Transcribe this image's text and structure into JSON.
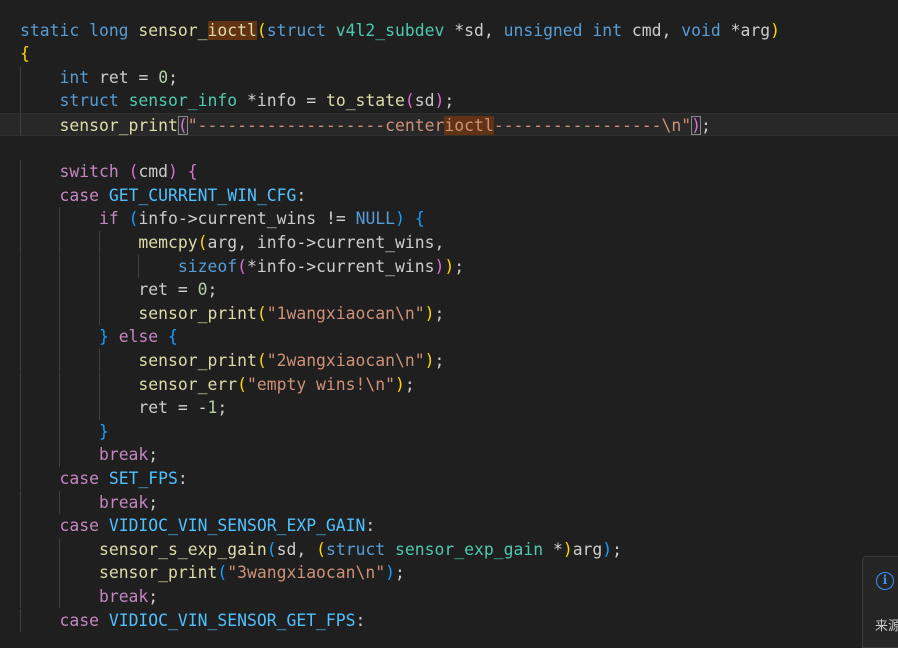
{
  "editor": {
    "language": "c",
    "current_line": 4,
    "highlight_word": "ioctl",
    "lines": [
      [
        [
          "static ",
          "kw"
        ],
        [
          "long ",
          "kw"
        ],
        [
          "sensor_",
          "fn"
        ],
        [
          "ioctl",
          "fn hl"
        ],
        [
          "(",
          "b1"
        ],
        [
          "struct ",
          "kw"
        ],
        [
          "v4l2_subdev ",
          "type"
        ],
        [
          "*",
          "op"
        ],
        [
          "sd",
          ""
        ],
        [
          ", ",
          ""
        ],
        [
          "unsigned ",
          "kw"
        ],
        [
          "int ",
          "kw"
        ],
        [
          "cmd",
          ""
        ],
        [
          ", ",
          ""
        ],
        [
          "void ",
          "kw"
        ],
        [
          "*",
          "op"
        ],
        [
          "arg",
          ""
        ],
        [
          ")",
          "b1"
        ]
      ],
      [
        [
          "{",
          "b1"
        ]
      ],
      [
        [
          "    ",
          ""
        ],
        [
          "int ",
          "kw"
        ],
        [
          "ret",
          ""
        ],
        [
          " = ",
          "op"
        ],
        [
          "0",
          "num"
        ],
        [
          ";",
          ""
        ]
      ],
      [
        [
          "    ",
          ""
        ],
        [
          "struct ",
          "kw"
        ],
        [
          "sensor_info ",
          "type"
        ],
        [
          "*",
          "op"
        ],
        [
          "info",
          ""
        ],
        [
          " = ",
          "op"
        ],
        [
          "to_state",
          "fn"
        ],
        [
          "(",
          "b2"
        ],
        [
          "sd",
          ""
        ],
        [
          ")",
          "b2"
        ],
        [
          ";",
          ""
        ]
      ],
      [
        [
          "    ",
          ""
        ],
        [
          "sensor_print",
          "fn"
        ],
        [
          "(",
          "b2 bm"
        ],
        [
          "\"-------------------center",
          "str"
        ],
        [
          "ioctl",
          "str hl"
        ],
        [
          "-----------------\\n\"",
          "str"
        ],
        [
          ")",
          "b2 bm"
        ],
        [
          ";",
          ""
        ]
      ],
      [],
      [
        [
          "    ",
          ""
        ],
        [
          "switch ",
          "ctrl"
        ],
        [
          "(",
          "b2"
        ],
        [
          "cmd",
          ""
        ],
        [
          ") ",
          "b2"
        ],
        [
          "{",
          "b2"
        ]
      ],
      [
        [
          "    ",
          ""
        ],
        [
          "case ",
          "ctrl"
        ],
        [
          "GET_CURRENT_WIN_CFG",
          "mac"
        ],
        [
          ":",
          ""
        ]
      ],
      [
        [
          "        ",
          ""
        ],
        [
          "if ",
          "ctrl"
        ],
        [
          "(",
          "b3"
        ],
        [
          "info",
          ""
        ],
        [
          "->",
          "op"
        ],
        [
          "current_wins",
          ""
        ],
        [
          " != ",
          "op"
        ],
        [
          "NULL",
          "const"
        ],
        [
          ") ",
          "b3"
        ],
        [
          "{",
          "b3"
        ]
      ],
      [
        [
          "            ",
          ""
        ],
        [
          "memcpy",
          "fn"
        ],
        [
          "(",
          "b1"
        ],
        [
          "arg",
          ""
        ],
        [
          ", ",
          ""
        ],
        [
          "info",
          ""
        ],
        [
          "->",
          "op"
        ],
        [
          "current_wins",
          ""
        ],
        [
          ",",
          ""
        ]
      ],
      [
        [
          "                ",
          ""
        ],
        [
          "sizeof",
          "kw"
        ],
        [
          "(",
          "b2"
        ],
        [
          "*",
          "op"
        ],
        [
          "info",
          ""
        ],
        [
          "->",
          "op"
        ],
        [
          "current_wins",
          ""
        ],
        [
          ")",
          "b2"
        ],
        [
          ")",
          "b1"
        ],
        [
          ";",
          ""
        ]
      ],
      [
        [
          "            ",
          ""
        ],
        [
          "ret",
          ""
        ],
        [
          " = ",
          "op"
        ],
        [
          "0",
          "num"
        ],
        [
          ";",
          ""
        ]
      ],
      [
        [
          "            ",
          ""
        ],
        [
          "sensor_print",
          "fn"
        ],
        [
          "(",
          "b1"
        ],
        [
          "\"1wangxiaocan\\n\"",
          "str"
        ],
        [
          ")",
          "b1"
        ],
        [
          ";",
          ""
        ]
      ],
      [
        [
          "        ",
          ""
        ],
        [
          "} ",
          "b3"
        ],
        [
          "else ",
          "ctrl"
        ],
        [
          "{",
          "b3"
        ]
      ],
      [
        [
          "            ",
          ""
        ],
        [
          "sensor_print",
          "fn"
        ],
        [
          "(",
          "b1"
        ],
        [
          "\"2wangxiaocan\\n\"",
          "str"
        ],
        [
          ")",
          "b1"
        ],
        [
          ";",
          ""
        ]
      ],
      [
        [
          "            ",
          ""
        ],
        [
          "sensor_err",
          "fn"
        ],
        [
          "(",
          "b1"
        ],
        [
          "\"empty wins!\\n\"",
          "str"
        ],
        [
          ")",
          "b1"
        ],
        [
          ";",
          ""
        ]
      ],
      [
        [
          "            ",
          ""
        ],
        [
          "ret",
          ""
        ],
        [
          " = ",
          "op"
        ],
        [
          "-",
          "op"
        ],
        [
          "1",
          "num"
        ],
        [
          ";",
          ""
        ]
      ],
      [
        [
          "        ",
          ""
        ],
        [
          "}",
          "b3"
        ]
      ],
      [
        [
          "        ",
          ""
        ],
        [
          "break",
          "ctrl"
        ],
        [
          ";",
          ""
        ]
      ],
      [
        [
          "    ",
          ""
        ],
        [
          "case ",
          "ctrl"
        ],
        [
          "SET_FPS",
          "mac"
        ],
        [
          ":",
          ""
        ]
      ],
      [
        [
          "        ",
          ""
        ],
        [
          "break",
          "ctrl"
        ],
        [
          ";",
          ""
        ]
      ],
      [
        [
          "    ",
          ""
        ],
        [
          "case ",
          "ctrl"
        ],
        [
          "VIDIOC_VIN_SENSOR_EXP_GAIN",
          "mac"
        ],
        [
          ":",
          ""
        ]
      ],
      [
        [
          "        ",
          ""
        ],
        [
          "sensor_s_exp_gain",
          "fn"
        ],
        [
          "(",
          "b3"
        ],
        [
          "sd",
          ""
        ],
        [
          ", ",
          ""
        ],
        [
          "(",
          "b1"
        ],
        [
          "struct ",
          "kw"
        ],
        [
          "sensor_exp_gain ",
          "type"
        ],
        [
          "*",
          "op"
        ],
        [
          ")",
          "b1"
        ],
        [
          "arg",
          ""
        ],
        [
          ")",
          "b3"
        ],
        [
          ";",
          ""
        ]
      ],
      [
        [
          "        ",
          ""
        ],
        [
          "sensor_print",
          "fn"
        ],
        [
          "(",
          "b3"
        ],
        [
          "\"3wangxiaocan\\n\"",
          "str"
        ],
        [
          ")",
          "b3"
        ],
        [
          ";",
          ""
        ]
      ],
      [
        [
          "        ",
          ""
        ],
        [
          "break",
          "ctrl"
        ],
        [
          ";",
          ""
        ]
      ],
      [
        [
          "    ",
          ""
        ],
        [
          "case ",
          "ctrl"
        ],
        [
          "VIDIOC_VIN_SENSOR_GET_FPS",
          "mac"
        ],
        [
          ":",
          ""
        ]
      ]
    ]
  },
  "info_widget": {
    "icon": "info-icon",
    "icon_glyph": "i",
    "text": "来源"
  },
  "colors": {
    "background": "#1f1f1f",
    "keyword": "#569cd6",
    "control": "#c586c0",
    "function": "#dcdcaa",
    "type": "#4ec9b0",
    "string": "#ce9178",
    "number": "#b5cea8",
    "macro": "#4fc1ff",
    "highlight": "#613214"
  }
}
